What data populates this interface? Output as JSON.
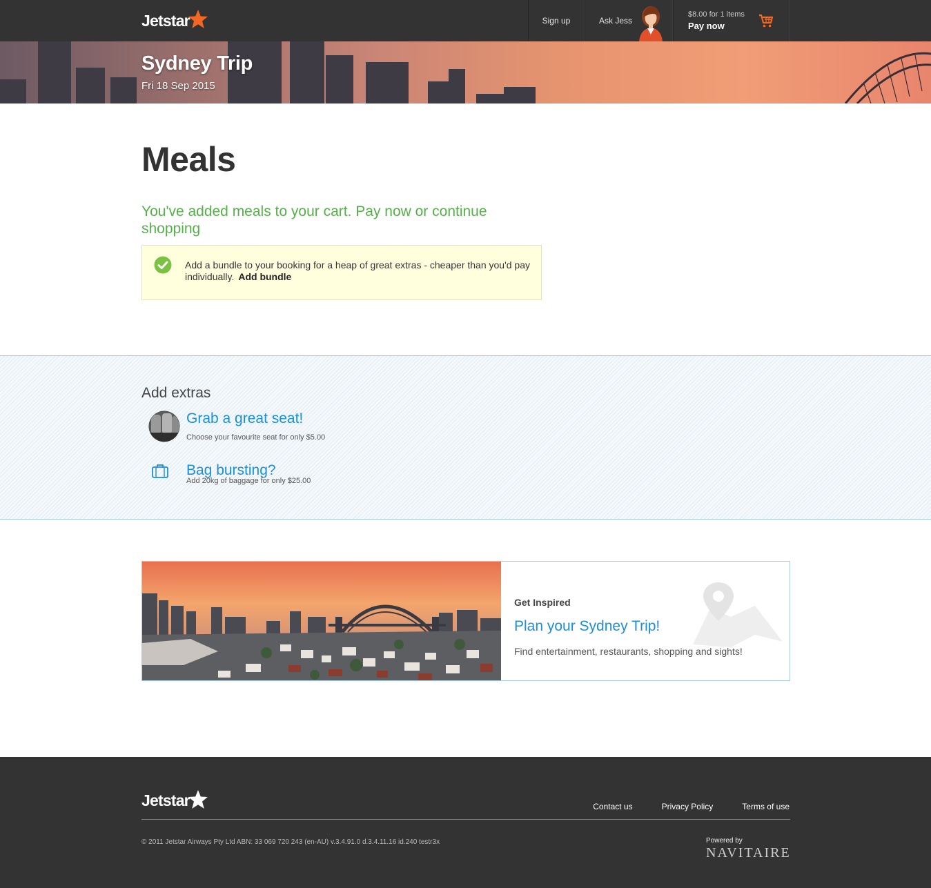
{
  "header": {
    "logo_text": "Jetstar",
    "signup_label": "Sign up",
    "ask_jess_label": "Ask Jess",
    "cart_amount": "$8.00 for 1 items",
    "cart_pay_label": "Pay now"
  },
  "hero": {
    "title": "Sydney Trip",
    "date": "Fri 18 Sep 2015"
  },
  "main": {
    "page_title": "Meals",
    "success_message": "You've added meals to your cart. Pay now or continue shopping",
    "bundle_text": "Add a bundle to your booking for a heap of great extras - cheaper than you'd pay individually.",
    "bundle_link": "Add bundle"
  },
  "extras": {
    "title": "Add extras",
    "items": [
      {
        "name": "Grab a great seat!",
        "desc": "Choose your favourite seat for only $5.00",
        "icon": "seat-icon"
      },
      {
        "name": "Bag bursting?",
        "desc": "Add 20kg of baggage for only $25.00",
        "icon": "luggage-icon"
      }
    ]
  },
  "inspire": {
    "label": "Get Inspired",
    "title": "Plan your Sydney Trip!",
    "desc": "Find entertainment, restaurants, shopping and sights!"
  },
  "footer": {
    "logo_text": "Jetstar",
    "links": [
      "Contact us",
      "Privacy Policy",
      "Terms of use"
    ],
    "copyright": "© 2011 Jetstar Airways Pty Ltd ABN: 33 069 720 243 (en-AU) v.3.4.91.0 d.3.4.11.16  id.240 testr3x",
    "powered_by": "Powered by",
    "powered_brand": "NAVITAIRE"
  },
  "colors": {
    "brand_orange": "#f26722",
    "success_green": "#56b04a",
    "link_blue": "#1a8fdc",
    "header_bg": "#333333"
  }
}
